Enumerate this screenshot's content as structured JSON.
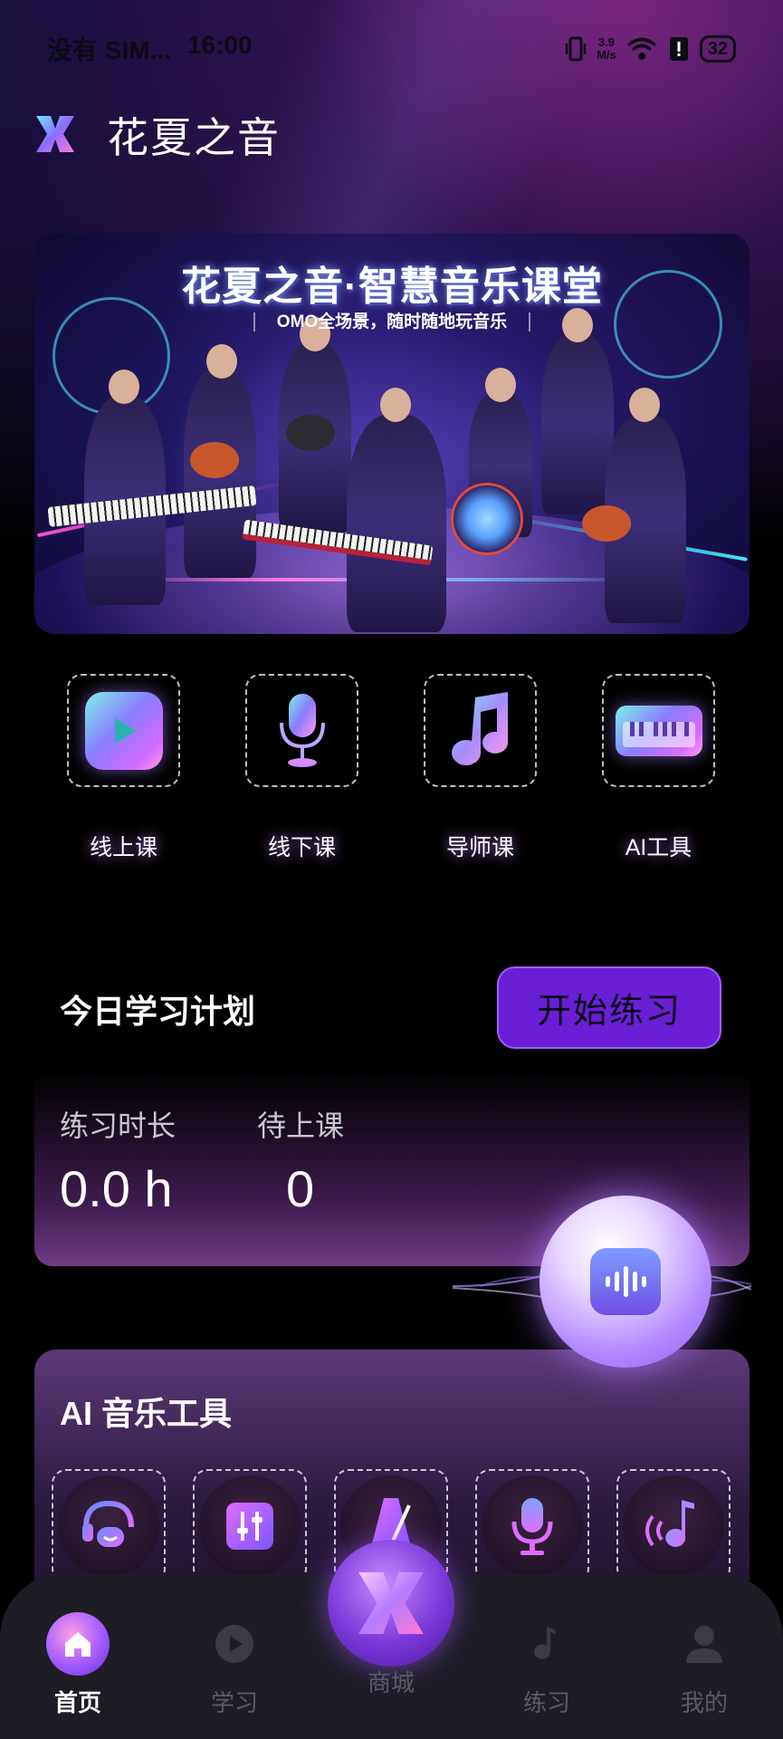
{
  "status_bar": {
    "carrier": "没有 SIM...",
    "time": "16:00",
    "speed_value": "3.9",
    "speed_unit": "M/s",
    "battery": "32"
  },
  "header": {
    "title": "花夏之音"
  },
  "banner": {
    "title": "花夏之音·智慧音乐课堂",
    "subtitle": "OMO全场景，随时随地玩音乐"
  },
  "shortcuts": [
    {
      "label": "线上课",
      "icon": "play-icon"
    },
    {
      "label": "线下课",
      "icon": "microphone-icon"
    },
    {
      "label": "导师课",
      "icon": "music-note-icon"
    },
    {
      "label": "AI工具",
      "icon": "keyboard-icon"
    }
  ],
  "plan": {
    "title": "今日学习计划",
    "start_button": "开始练习",
    "practice_label": "练习时长",
    "practice_value": "0.0 h",
    "pending_label": "待上课",
    "pending_value": "0"
  },
  "ai_tools": {
    "title": "AI 音乐工具",
    "items": [
      "headset-chat-icon",
      "mixer-icon",
      "metronome-icon",
      "microphone-icon",
      "sound-note-icon"
    ]
  },
  "bottom_nav": {
    "home": "首页",
    "study": "学习",
    "mall": "商城",
    "practice": "练习",
    "mine": "我的"
  },
  "colors": {
    "accent": "#6a1fd6",
    "accent_border": "#a15dff",
    "nav_bg": "#1e1d26",
    "nav_inactive": "#5b5a66"
  }
}
